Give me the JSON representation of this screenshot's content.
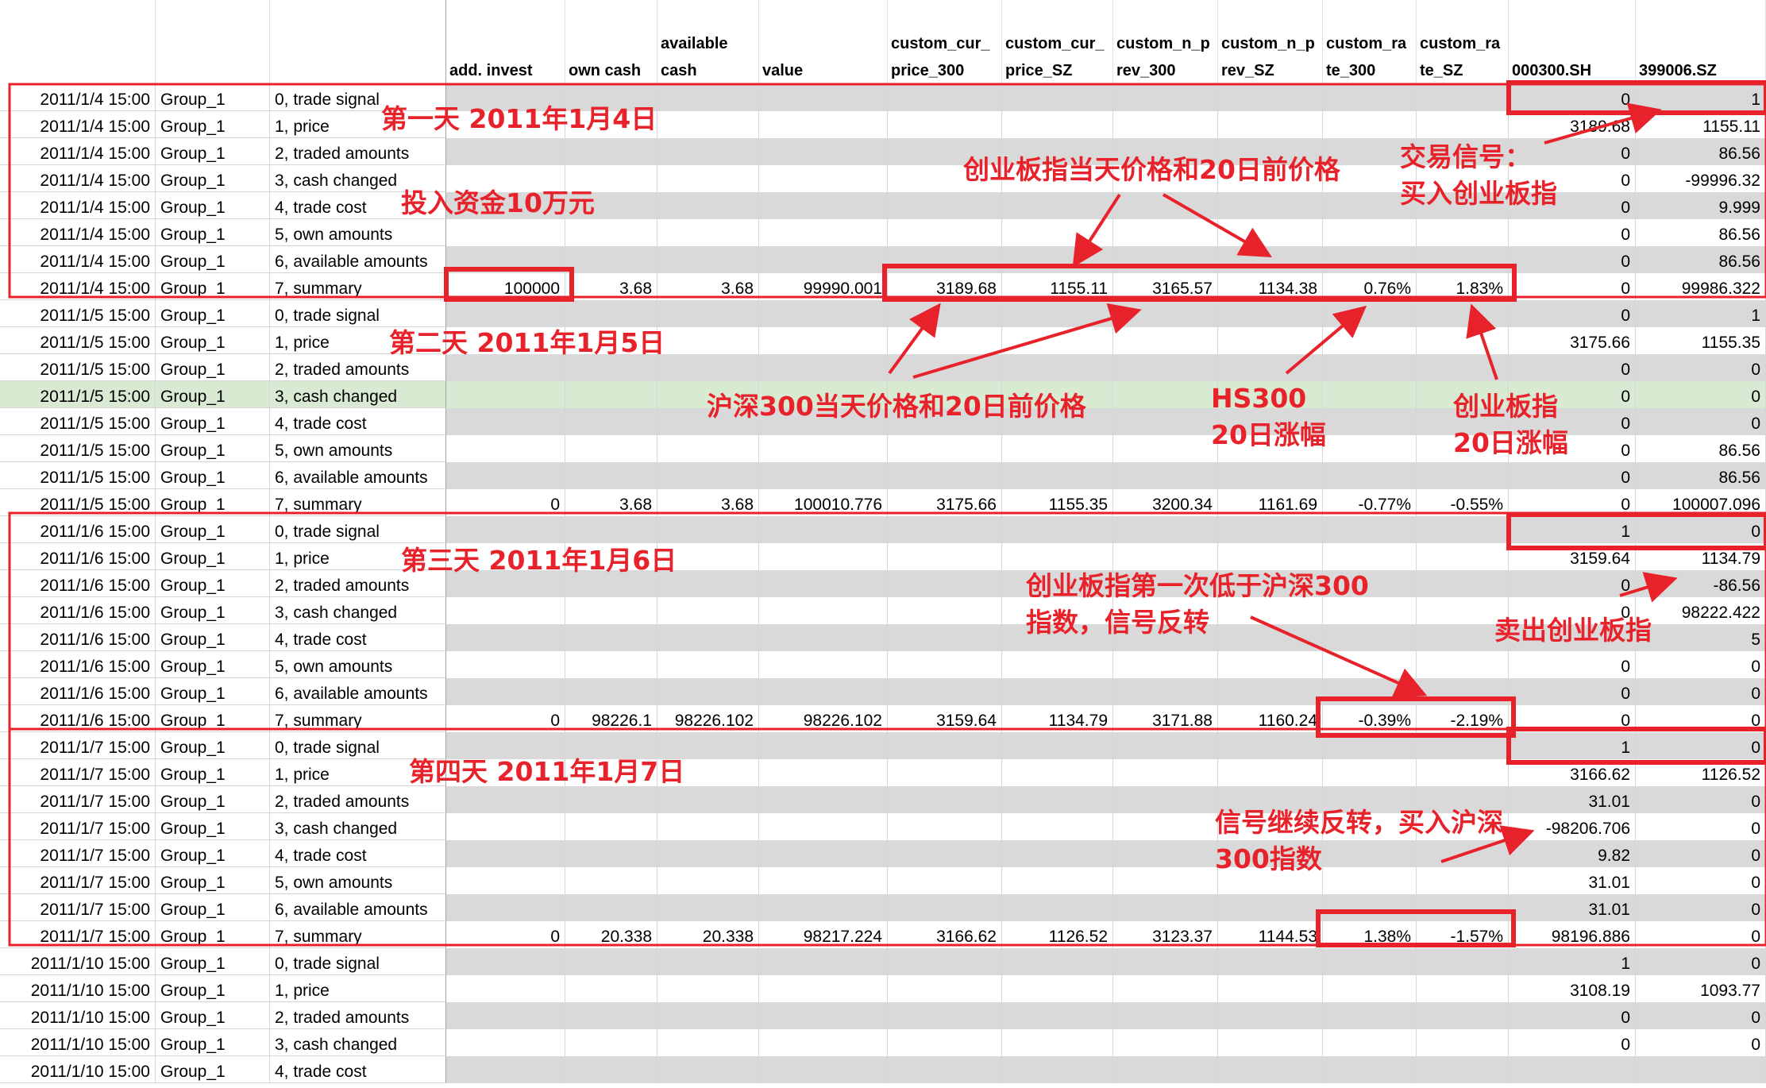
{
  "headers": [
    {
      "col": 3,
      "l1": "",
      "l2": "add. invest"
    },
    {
      "col": 4,
      "l1": "",
      "l2": "own cash"
    },
    {
      "col": 5,
      "l1": "available",
      "l2": "cash"
    },
    {
      "col": 6,
      "l1": "",
      "l2": "value"
    },
    {
      "col": 7,
      "l1": "custom_cur_",
      "l2": "price_300"
    },
    {
      "col": 8,
      "l1": "custom_cur_",
      "l2": "price_SZ"
    },
    {
      "col": 9,
      "l1": "custom_n_p",
      "l2": "rev_300"
    },
    {
      "col": 10,
      "l1": "custom_n_p",
      "l2": "rev_SZ"
    },
    {
      "col": 11,
      "l1": "custom_ra",
      "l2": "te_300"
    },
    {
      "col": 12,
      "l1": "custom_ra",
      "l2": "te_SZ"
    },
    {
      "col": 13,
      "l1": "",
      "l2": "000300.SH"
    },
    {
      "col": 14,
      "l1": "",
      "l2": "399006.SZ"
    }
  ],
  "rows": [
    [
      "2011/1/4 15:00",
      "Group_1",
      "0, trade signal",
      "",
      "",
      "",
      "",
      "",
      "",
      "",
      "",
      "",
      "",
      "0",
      "1"
    ],
    [
      "2011/1/4 15:00",
      "Group_1",
      "1, price",
      "",
      "",
      "",
      "",
      "",
      "",
      "",
      "",
      "",
      "",
      "3189.68",
      "1155.11"
    ],
    [
      "2011/1/4 15:00",
      "Group_1",
      "2, traded amounts",
      "",
      "",
      "",
      "",
      "",
      "",
      "",
      "",
      "",
      "",
      "0",
      "86.56"
    ],
    [
      "2011/1/4 15:00",
      "Group_1",
      "3, cash changed",
      "",
      "",
      "",
      "",
      "",
      "",
      "",
      "",
      "",
      "",
      "0",
      "-99996.32"
    ],
    [
      "2011/1/4 15:00",
      "Group_1",
      "4, trade cost",
      "",
      "",
      "",
      "",
      "",
      "",
      "",
      "",
      "",
      "",
      "0",
      "9.999"
    ],
    [
      "2011/1/4 15:00",
      "Group_1",
      "5, own amounts",
      "",
      "",
      "",
      "",
      "",
      "",
      "",
      "",
      "",
      "",
      "0",
      "86.56"
    ],
    [
      "2011/1/4 15:00",
      "Group_1",
      "6, available amounts",
      "",
      "",
      "",
      "",
      "",
      "",
      "",
      "",
      "",
      "",
      "0",
      "86.56"
    ],
    [
      "2011/1/4 15:00",
      "Group_1",
      "7, summary",
      "100000",
      "3.68",
      "3.68",
      "99990.001",
      "3189.68",
      "1155.11",
      "3165.57",
      "1134.38",
      "0.76%",
      "1.83%",
      "0",
      "99986.322"
    ],
    [
      "2011/1/5 15:00",
      "Group_1",
      "0, trade signal",
      "",
      "",
      "",
      "",
      "",
      "",
      "",
      "",
      "",
      "",
      "0",
      "1"
    ],
    [
      "2011/1/5 15:00",
      "Group_1",
      "1, price",
      "",
      "",
      "",
      "",
      "",
      "",
      "",
      "",
      "",
      "",
      "3175.66",
      "1155.35"
    ],
    [
      "2011/1/5 15:00",
      "Group_1",
      "2, traded amounts",
      "",
      "",
      "",
      "",
      "",
      "",
      "",
      "",
      "",
      "",
      "0",
      "0"
    ],
    [
      "2011/1/5 15:00",
      "Group_1",
      "3, cash changed",
      "",
      "",
      "",
      "",
      "",
      "",
      "",
      "",
      "",
      "",
      "0",
      "0"
    ],
    [
      "2011/1/5 15:00",
      "Group_1",
      "4, trade cost",
      "",
      "",
      "",
      "",
      "",
      "",
      "",
      "",
      "",
      "",
      "0",
      "0"
    ],
    [
      "2011/1/5 15:00",
      "Group_1",
      "5, own amounts",
      "",
      "",
      "",
      "",
      "",
      "",
      "",
      "",
      "",
      "",
      "0",
      "86.56"
    ],
    [
      "2011/1/5 15:00",
      "Group_1",
      "6, available amounts",
      "",
      "",
      "",
      "",
      "",
      "",
      "",
      "",
      "",
      "",
      "0",
      "86.56"
    ],
    [
      "2011/1/5 15:00",
      "Group_1",
      "7, summary",
      "0",
      "3.68",
      "3.68",
      "100010.776",
      "3175.66",
      "1155.35",
      "3200.34",
      "1161.69",
      "-0.77%",
      "-0.55%",
      "0",
      "100007.096"
    ],
    [
      "2011/1/6 15:00",
      "Group_1",
      "0, trade signal",
      "",
      "",
      "",
      "",
      "",
      "",
      "",
      "",
      "",
      "",
      "1",
      "0"
    ],
    [
      "2011/1/6 15:00",
      "Group_1",
      "1, price",
      "",
      "",
      "",
      "",
      "",
      "",
      "",
      "",
      "",
      "",
      "3159.64",
      "1134.79"
    ],
    [
      "2011/1/6 15:00",
      "Group_1",
      "2, traded amounts",
      "",
      "",
      "",
      "",
      "",
      "",
      "",
      "",
      "",
      "",
      "0",
      "-86.56"
    ],
    [
      "2011/1/6 15:00",
      "Group_1",
      "3, cash changed",
      "",
      "",
      "",
      "",
      "",
      "",
      "",
      "",
      "",
      "",
      "0",
      "98222.422"
    ],
    [
      "2011/1/6 15:00",
      "Group_1",
      "4, trade cost",
      "",
      "",
      "",
      "",
      "",
      "",
      "",
      "",
      "",
      "",
      "",
      "5"
    ],
    [
      "2011/1/6 15:00",
      "Group_1",
      "5, own amounts",
      "",
      "",
      "",
      "",
      "",
      "",
      "",
      "",
      "",
      "",
      "0",
      "0"
    ],
    [
      "2011/1/6 15:00",
      "Group_1",
      "6, available amounts",
      "",
      "",
      "",
      "",
      "",
      "",
      "",
      "",
      "",
      "",
      "0",
      "0"
    ],
    [
      "2011/1/6 15:00",
      "Group_1",
      "7, summary",
      "0",
      "98226.1",
      "98226.102",
      "98226.102",
      "3159.64",
      "1134.79",
      "3171.88",
      "1160.24",
      "-0.39%",
      "-2.19%",
      "0",
      "0"
    ],
    [
      "2011/1/7 15:00",
      "Group_1",
      "0, trade signal",
      "",
      "",
      "",
      "",
      "",
      "",
      "",
      "",
      "",
      "",
      "1",
      "0"
    ],
    [
      "2011/1/7 15:00",
      "Group_1",
      "1, price",
      "",
      "",
      "",
      "",
      "",
      "",
      "",
      "",
      "",
      "",
      "3166.62",
      "1126.52"
    ],
    [
      "2011/1/7 15:00",
      "Group_1",
      "2, traded amounts",
      "",
      "",
      "",
      "",
      "",
      "",
      "",
      "",
      "",
      "",
      "31.01",
      "0"
    ],
    [
      "2011/1/7 15:00",
      "Group_1",
      "3, cash changed",
      "",
      "",
      "",
      "",
      "",
      "",
      "",
      "",
      "",
      "",
      "-98206.706",
      "0"
    ],
    [
      "2011/1/7 15:00",
      "Group_1",
      "4, trade cost",
      "",
      "",
      "",
      "",
      "",
      "",
      "",
      "",
      "",
      "",
      "9.82",
      "0"
    ],
    [
      "2011/1/7 15:00",
      "Group_1",
      "5, own amounts",
      "",
      "",
      "",
      "",
      "",
      "",
      "",
      "",
      "",
      "",
      "31.01",
      "0"
    ],
    [
      "2011/1/7 15:00",
      "Group_1",
      "6, available amounts",
      "",
      "",
      "",
      "",
      "",
      "",
      "",
      "",
      "",
      "",
      "31.01",
      "0"
    ],
    [
      "2011/1/7 15:00",
      "Group_1",
      "7, summary",
      "0",
      "20.338",
      "20.338",
      "98217.224",
      "3166.62",
      "1126.52",
      "3123.37",
      "1144.53",
      "1.38%",
      "-1.57%",
      "98196.886",
      "0"
    ],
    [
      "2011/1/10 15:00",
      "Group_1",
      "0, trade signal",
      "",
      "",
      "",
      "",
      "",
      "",
      "",
      "",
      "",
      "",
      "1",
      "0"
    ],
    [
      "2011/1/10 15:00",
      "Group_1",
      "1, price",
      "",
      "",
      "",
      "",
      "",
      "",
      "",
      "",
      "",
      "",
      "3108.19",
      "1093.77"
    ],
    [
      "2011/1/10 15:00",
      "Group_1",
      "2, traded amounts",
      "",
      "",
      "",
      "",
      "",
      "",
      "",
      "",
      "",
      "",
      "0",
      "0"
    ],
    [
      "2011/1/10 15:00",
      "Group_1",
      "3, cash changed",
      "",
      "",
      "",
      "",
      "",
      "",
      "",
      "",
      "",
      "",
      "0",
      "0"
    ],
    [
      "2011/1/10 15:00",
      "Group_1",
      "4, trade cost",
      "",
      "",
      "",
      "",
      "",
      "",
      "",
      "",
      "",
      "",
      "",
      ""
    ]
  ],
  "highlighted_row": 11,
  "colors": {
    "annotation_red": "#e8222a",
    "stripe_gray": "#d9d9d9",
    "highlight_green": "#d9ead3",
    "grid": "#d6d6d6"
  },
  "annotations": {
    "day1": "第一天 2011年1月4日",
    "invest": "投入资金10万元",
    "cy_prices": "创业板指当天价格和20日前价格",
    "signal_title": "交易信号：",
    "signal_buy_cy": "买入创业板指",
    "day2": "第二天 2011年1月5日",
    "hs_prices": "沪深300当天价格和20日前价格",
    "hs_rate_1": "HS300",
    "hs_rate_2": "20日涨幅",
    "cy_rate_1": "创业板指",
    "cy_rate_2": "20日涨幅",
    "day3": "第三天 2011年1月6日",
    "reverse_1": "创业板指第一次低于沪深300",
    "reverse_2": "指数，信号反转",
    "sell_cy": "卖出创业板指",
    "day4": "第四天 2011年1月7日",
    "buy_hs_1": "信号继续反转，买入沪深",
    "buy_hs_2": "300指数"
  }
}
